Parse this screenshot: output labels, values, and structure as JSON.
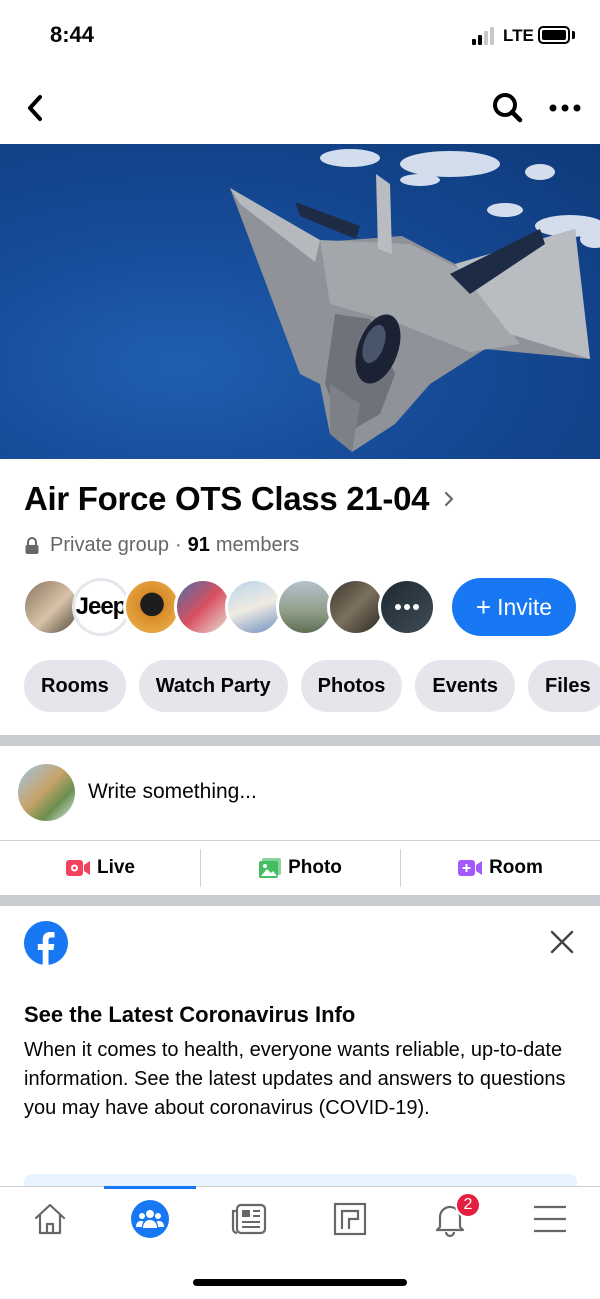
{
  "status_bar": {
    "time": "8:44",
    "network": "LTE"
  },
  "nav": {
    "back_icon": "chevron-left-icon",
    "search_icon": "search-icon",
    "more_icon": "more-icon"
  },
  "cover": {
    "subject": "jet-aircraft-image",
    "sky_color": "#174c99"
  },
  "group": {
    "title": "Air Force OTS Class 21-04",
    "privacy": "Private group",
    "separator": "·",
    "member_count": "91",
    "members_label": "members"
  },
  "members": {
    "avatar_count_shown": 9,
    "jeep_avatar_text": "Jeep",
    "invite_label": "Invite",
    "invite_plus": "+"
  },
  "chips": [
    "Rooms",
    "Watch Party",
    "Photos",
    "Events",
    "Files"
  ],
  "composer": {
    "placeholder": "Write something...",
    "actions": [
      {
        "label": "Live",
        "icon": "live-video-icon",
        "color": "#f3425f"
      },
      {
        "label": "Photo",
        "icon": "photo-icon",
        "color": "#45bd62"
      },
      {
        "label": "Room",
        "icon": "room-video-icon",
        "color": "#a259ff"
      }
    ]
  },
  "info_card": {
    "title": "See the Latest Coronavirus Info",
    "body": "When it comes to health, everyone wants reliable, up-to-date information. See the latest updates and answers to questions you may have about coronavirus (COVID-19)."
  },
  "tab_bar": {
    "tabs": [
      "home-icon",
      "groups-icon",
      "news-icon",
      "marketplace-icon",
      "notifications-icon",
      "menu-icon"
    ],
    "active": "groups-icon",
    "notification_badge": "2"
  },
  "colors": {
    "accent": "#1877f2",
    "chip_bg": "#e4e6eb",
    "badge": "#e41e3f"
  }
}
